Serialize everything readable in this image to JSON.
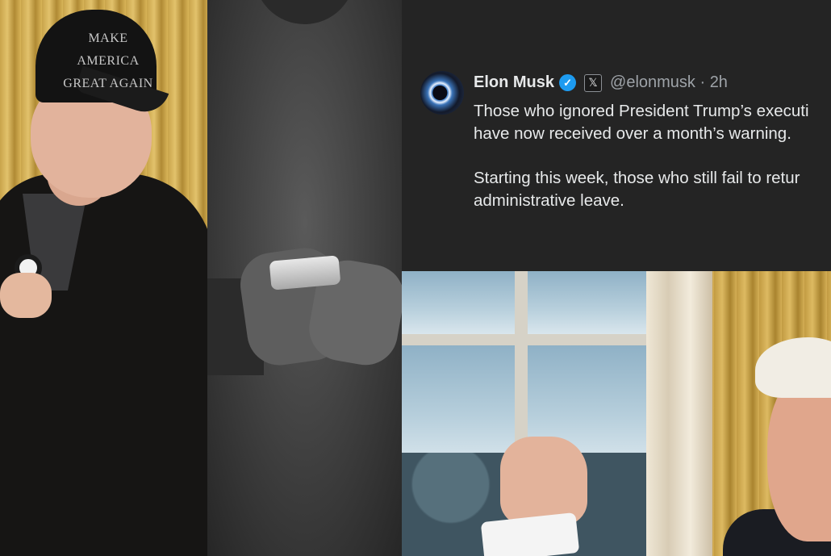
{
  "left_photo": {
    "cap_text_line1": "MAKE AMERICA",
    "cap_text_line2": "GREAT AGAIN"
  },
  "tweet": {
    "author_name": "Elon Musk",
    "verified_icon": "verified-badge-icon",
    "platform_icon": "x-logo-icon",
    "platform_glyph": "𝕏",
    "handle_time": "@elonmusk · 2h",
    "paragraph1": "Those who ignored President Trump’s executi have now received over a month’s warning.",
    "paragraph1_line1": "Those who ignored President Trump’s executi",
    "paragraph1_line2": "have now received over a month’s warning.",
    "paragraph2_line1": "Starting this week, those who still fail to retur",
    "paragraph2_line2": "administrative leave.",
    "colors": {
      "background": "#242424",
      "text": "#e7e9ea",
      "muted": "#9ea3a8",
      "verified": "#1d9bf0"
    }
  }
}
